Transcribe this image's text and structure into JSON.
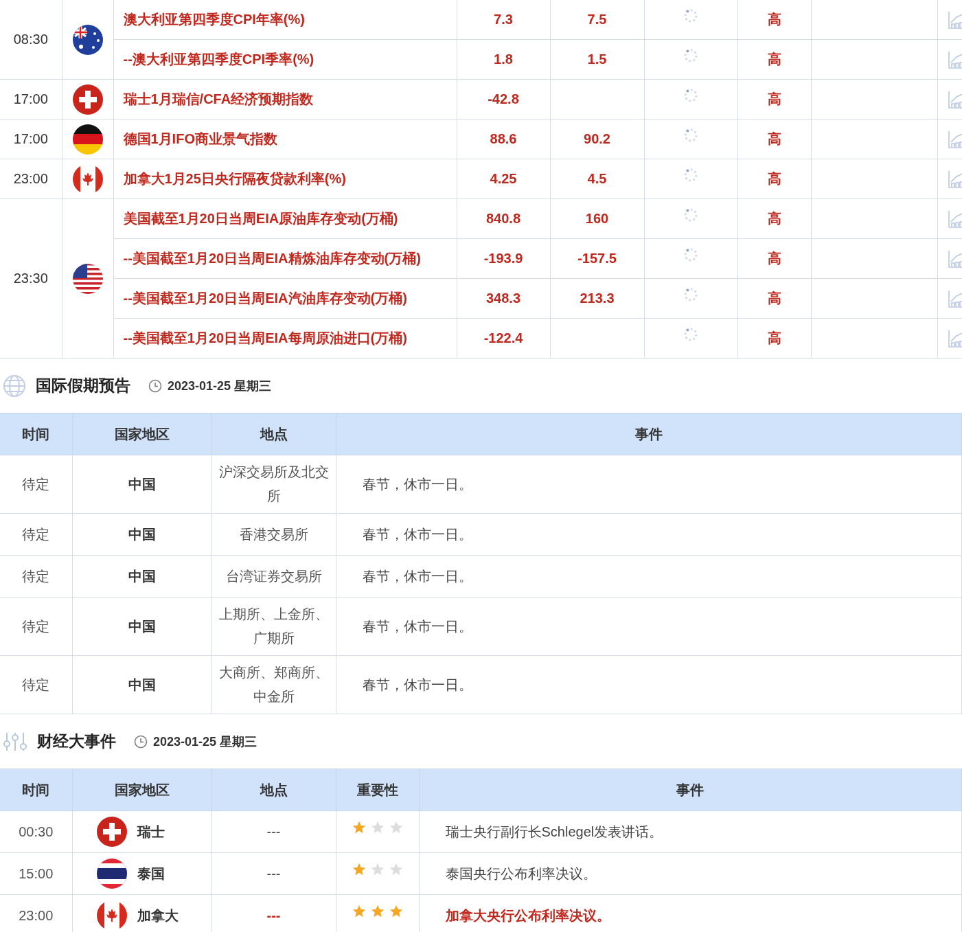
{
  "indicators": [
    {
      "time": "08:30",
      "kind": "au",
      "items": [
        {
          "name": "澳大利亚第四季度CPI年率(%)",
          "previous": "7.3",
          "forecast": "7.5",
          "importance": "高"
        },
        {
          "name": "--澳大利亚第四季度CPI季率(%)",
          "previous": "1.8",
          "forecast": "1.5",
          "importance": "高"
        }
      ]
    },
    {
      "time": "17:00",
      "kind": "ch",
      "items": [
        {
          "name": "瑞士1月瑞信/CFA经济预期指数",
          "previous": "-42.8",
          "importance": "高"
        }
      ]
    },
    {
      "time": "17:00",
      "kind": "de",
      "items": [
        {
          "name": "德国1月IFO商业景气指数",
          "previous": "88.6",
          "forecast": "90.2",
          "importance": "高"
        }
      ]
    },
    {
      "time": "23:00",
      "kind": "ca",
      "items": [
        {
          "name": "加拿大1月25日央行隔夜贷款利率(%)",
          "previous": "4.25",
          "forecast": "4.5",
          "importance": "高"
        }
      ]
    },
    {
      "time": "23:30",
      "kind": "us",
      "items": [
        {
          "name": "美国截至1月20日当周EIA原油库存变动(万桶)",
          "previous": "840.8",
          "forecast": "160",
          "importance": "高"
        },
        {
          "name": "--美国截至1月20日当周EIA精炼油库存变动(万桶)",
          "previous": "-193.9",
          "forecast": "-157.5",
          "importance": "高"
        },
        {
          "name": "--美国截至1月20日当周EIA汽油库存变动(万桶)",
          "previous": "348.3",
          "forecast": "213.3",
          "importance": "高"
        },
        {
          "name": "--美国截至1月20日当周EIA每周原油进口(万桶)",
          "previous": "-122.4",
          "importance": "高"
        }
      ]
    }
  ],
  "holidays": {
    "title": "国际假期预告",
    "date": "2023-01-25 星期三",
    "columns": [
      "时间",
      "国家地区",
      "地点",
      "事件"
    ],
    "rows": [
      {
        "time": "待定",
        "country": "中国",
        "place": "沪深交易所及北交所",
        "event": "春节，休市一日。"
      },
      {
        "time": "待定",
        "country": "中国",
        "place": "香港交易所",
        "event": "春节，休市一日。"
      },
      {
        "time": "待定",
        "country": "中国",
        "place": "台湾证券交易所",
        "event": "春节，休市一日。"
      },
      {
        "time": "待定",
        "country": "中国",
        "place": "上期所、上金所、广期所",
        "event": "春节，休市一日。"
      },
      {
        "time": "待定",
        "country": "中国",
        "place": "大商所、郑商所、中金所",
        "event": "春节，休市一日。"
      }
    ]
  },
  "events": {
    "title": "财经大事件",
    "date": "2023-01-25 星期三",
    "columns": [
      "时间",
      "国家地区",
      "地点",
      "重要性",
      "事件"
    ],
    "rows": [
      {
        "time": "00:30",
        "kind": "ch",
        "country": "瑞士",
        "place": "---",
        "stars": 1,
        "event": "瑞士央行副行长Schlegel发表讲话。",
        "highlight": false
      },
      {
        "time": "15:00",
        "kind": "th",
        "country": "泰国",
        "place": "---",
        "stars": 1,
        "event": "泰国央行公布利率决议。",
        "highlight": false
      },
      {
        "time": "23:00",
        "kind": "ca",
        "country": "加拿大",
        "place": "---",
        "stars": 3,
        "event": "加拿大央行公布利率决议。",
        "highlight": true
      }
    ]
  }
}
